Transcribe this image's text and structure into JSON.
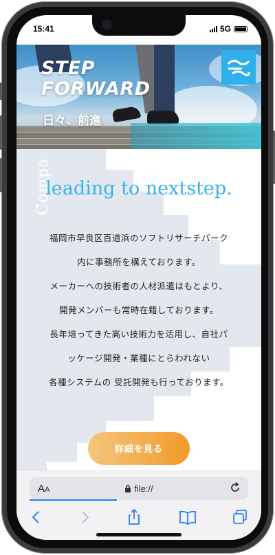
{
  "status_bar": {
    "time": "15:41",
    "network": "5G"
  },
  "hero": {
    "title_line1": "STEP",
    "title_line2": "FORWARD",
    "subtitle": "日々、前進",
    "logo_icon": "company-logo-icon"
  },
  "content": {
    "vertical_text": "Compa",
    "tagline": "leading to nextstep.",
    "body_lines": [
      "福岡市早良区百道浜のソフトリサーチパーク",
      "内に事務所を構えております。",
      "メーカーへの技術者の人材派遣はもとより、",
      "開発メンバーも常時在籍しております。",
      "長年培ってきた高い技術力を活用し、自社パ",
      "ッケージ開発・業種にとらわれない",
      "各種システムの 受託開発も行っております。"
    ],
    "cta_label": "詳細を見る"
  },
  "browser": {
    "text_size_label": "A",
    "text_size_small": "A",
    "url": "file://",
    "toolbar_icons": [
      "back-icon",
      "forward-icon",
      "share-icon",
      "bookmarks-icon",
      "tabs-icon"
    ]
  },
  "colors": {
    "accent_blue": "#35b3ea",
    "cta_gradient_start": "#f4c57b",
    "cta_gradient_end": "#f39a2c",
    "browser_blue": "#2f7cf6"
  }
}
